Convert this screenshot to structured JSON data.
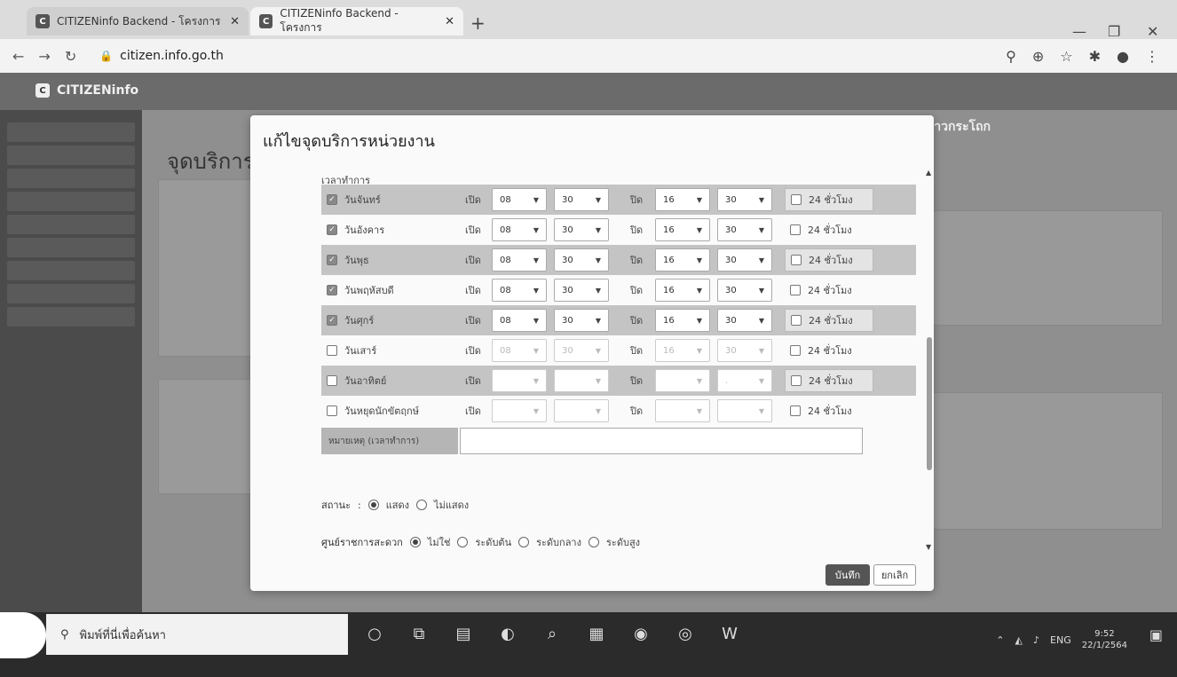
{
  "browser": {
    "tabs": [
      {
        "title": "CITIZENinfo Backend - โครงการ"
      },
      {
        "title": "CITIZENinfo Backend - โครงการ"
      }
    ],
    "url": "citizen.info.go.th"
  },
  "app": {
    "logo": "CITIZENinfo",
    "user_name": "กรรัตน์ กาวกระโถก",
    "page_title": "จุดบริการ"
  },
  "modal": {
    "title": "แก้ไขจุดบริการหน่วยงาน",
    "hours_label": "เวลาทำการ",
    "open_label": "เปิด",
    "close_label": "ปิด",
    "h24_label": "24 ชั่วโมง",
    "days": [
      {
        "name": "วันจันทร์",
        "checked": true,
        "open_h": "08",
        "open_m": "30",
        "close_h": "16",
        "close_m": "30"
      },
      {
        "name": "วันอังคาร",
        "checked": true,
        "open_h": "08",
        "open_m": "30",
        "close_h": "16",
        "close_m": "30"
      },
      {
        "name": "วันพุธ",
        "checked": true,
        "open_h": "08",
        "open_m": "30",
        "close_h": "16",
        "close_m": "30"
      },
      {
        "name": "วันพฤหัสบดี",
        "checked": true,
        "open_h": "08",
        "open_m": "30",
        "close_h": "16",
        "close_m": "30"
      },
      {
        "name": "วันศุกร์",
        "checked": true,
        "open_h": "08",
        "open_m": "30",
        "close_h": "16",
        "close_m": "30"
      },
      {
        "name": "วันเสาร์",
        "checked": false,
        "open_h": "08",
        "open_m": "30",
        "close_h": "16",
        "close_m": "30"
      },
      {
        "name": "วันอาทิตย์",
        "checked": false,
        "open_h": "",
        "open_m": "",
        "close_h": "",
        "close_m": "."
      },
      {
        "name": "วันหยุดนักขัตฤกษ์",
        "checked": false,
        "open_h": "",
        "open_m": "",
        "close_h": "",
        "close_m": ""
      }
    ],
    "note_label": "หมายเหตุ (เวลาทำการ)",
    "status_label": "สถานะ",
    "status_options": [
      "แสดง",
      "ไม่แสดง"
    ],
    "center_label": "ศูนย์ราชการสะดวก",
    "center_options": [
      "ไม่ใช่",
      "ระดับต้น",
      "ระดับกลาง",
      "ระดับสูง"
    ],
    "save_label": "บันทึก",
    "cancel_label": "ยกเลิก"
  },
  "taskbar": {
    "search_placeholder": "พิมพ์ที่นี่เพื่อค้นหา",
    "lang": "ENG",
    "time": "9:52",
    "date": "22/1/2564"
  }
}
